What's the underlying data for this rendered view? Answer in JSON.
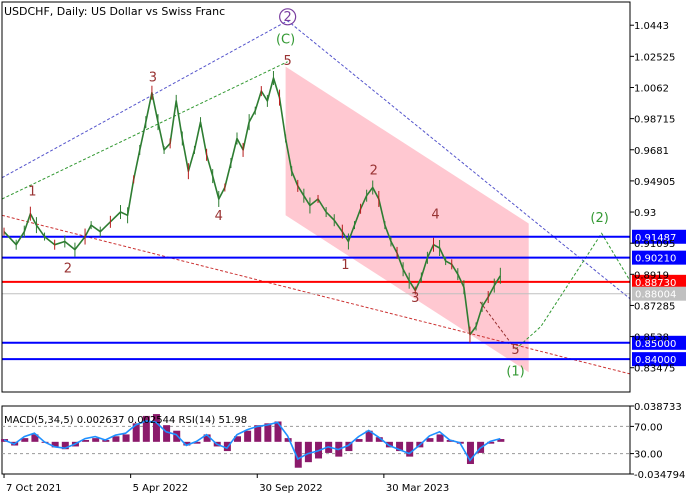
{
  "chart_data": {
    "type": "line",
    "title": "USDCHF, Daily:  US Dollar vs Swiss Franc",
    "price_axis": {
      "range": [
        0.8199,
        1.0585
      ],
      "ticks": [
        1.0443,
        1.02525,
        1.0062,
        0.98715,
        0.9681,
        0.94905,
        0.93,
        0.91095,
        0.8919,
        0.87285,
        0.8538,
        0.83475
      ]
    },
    "time_axis": {
      "labels": [
        {
          "label": "7 Oct 2021",
          "t": 0
        },
        {
          "label": "5 Apr 2022",
          "t": 125
        },
        {
          "label": "30 Sep 2022",
          "t": 250
        },
        {
          "label": "30 Mar 2023",
          "t": 375
        }
      ],
      "range": [
        -2,
        618
      ]
    },
    "price_path": [
      [
        0,
        0.918
      ],
      [
        12,
        0.91
      ],
      [
        20,
        0.918
      ],
      [
        26,
        0.929
      ],
      [
        32,
        0.922
      ],
      [
        40,
        0.915
      ],
      [
        50,
        0.91
      ],
      [
        60,
        0.912
      ],
      [
        70,
        0.907
      ],
      [
        80,
        0.915
      ],
      [
        86,
        0.922
      ],
      [
        95,
        0.918
      ],
      [
        105,
        0.924
      ],
      [
        115,
        0.93
      ],
      [
        122,
        0.928
      ],
      [
        128,
        0.95
      ],
      [
        134,
        0.968
      ],
      [
        140,
        0.985
      ],
      [
        146,
        1.003
      ],
      [
        152,
        0.985
      ],
      [
        158,
        0.968
      ],
      [
        164,
        0.972
      ],
      [
        170,
        0.998
      ],
      [
        176,
        0.975
      ],
      [
        182,
        0.955
      ],
      [
        188,
        0.968
      ],
      [
        194,
        0.985
      ],
      [
        200,
        0.965
      ],
      [
        206,
        0.952
      ],
      [
        212,
        0.938
      ],
      [
        218,
        0.945
      ],
      [
        224,
        0.96
      ],
      [
        230,
        0.975
      ],
      [
        236,
        0.968
      ],
      [
        242,
        0.985
      ],
      [
        248,
        0.992
      ],
      [
        254,
        1.004
      ],
      [
        260,
        0.998
      ],
      [
        266,
        1.012
      ],
      [
        272,
        1.0
      ],
      [
        278,
        0.975
      ],
      [
        284,
        0.955
      ],
      [
        290,
        0.946
      ],
      [
        296,
        0.94
      ],
      [
        302,
        0.934
      ],
      [
        310,
        0.938
      ],
      [
        318,
        0.93
      ],
      [
        326,
        0.925
      ],
      [
        334,
        0.918
      ],
      [
        340,
        0.912
      ],
      [
        346,
        0.922
      ],
      [
        352,
        0.932
      ],
      [
        358,
        0.94
      ],
      [
        364,
        0.945
      ],
      [
        370,
        0.938
      ],
      [
        376,
        0.922
      ],
      [
        382,
        0.912
      ],
      [
        388,
        0.905
      ],
      [
        394,
        0.895
      ],
      [
        400,
        0.888
      ],
      [
        406,
        0.882
      ],
      [
        412,
        0.89
      ],
      [
        418,
        0.902
      ],
      [
        424,
        0.91
      ],
      [
        430,
        0.908
      ],
      [
        436,
        0.9
      ],
      [
        442,
        0.898
      ],
      [
        448,
        0.892
      ],
      [
        454,
        0.884
      ],
      [
        460,
        0.855
      ],
      [
        466,
        0.86
      ],
      [
        472,
        0.872
      ],
      [
        478,
        0.878
      ],
      [
        484,
        0.885
      ],
      [
        490,
        0.891
      ]
    ],
    "horizontal_levels": [
      {
        "value": 0.91487,
        "label": "0.91487",
        "color": "#0000ff"
      },
      {
        "value": 0.9021,
        "label": "0.90210",
        "color": "#0000ff"
      },
      {
        "value": 0.8873,
        "label": "0.88730",
        "color": "#ff0000"
      },
      {
        "value": 0.88004,
        "label": "0.88004",
        "color": "#c0c0c0"
      },
      {
        "value": 0.85,
        "label": "0.85000",
        "color": "#0000ff"
      },
      {
        "value": 0.84,
        "label": "0.84000",
        "color": "#0000ff"
      }
    ],
    "channel": {
      "color": "#ffb6c1",
      "upper": [
        [
          278,
          1.019
        ],
        [
          518,
          0.923
        ]
      ],
      "lower": [
        [
          278,
          0.928
        ],
        [
          518,
          0.832
        ]
      ]
    },
    "trend_lines": [
      {
        "color": "#5555cc",
        "dash": true,
        "points": [
          [
            -2,
            0.951
          ],
          [
            280,
            1.047
          ],
          [
            618,
            0.877
          ]
        ]
      },
      {
        "color": "#cc3333",
        "dash": true,
        "points": [
          [
            -2,
            0.928
          ],
          [
            618,
            0.831
          ]
        ]
      },
      {
        "color": "#339933",
        "dash": true,
        "points": [
          [
            -2,
            0.938
          ],
          [
            280,
            1.022
          ]
        ]
      },
      {
        "color": "#339933",
        "dash": true,
        "points": [
          [
            505,
            0.846
          ],
          [
            530,
            0.86
          ],
          [
            590,
            0.917
          ],
          [
            618,
            0.888
          ]
        ]
      },
      {
        "color": "#993333",
        "dash": true,
        "points": [
          [
            470,
            0.875
          ],
          [
            505,
            0.846
          ]
        ]
      }
    ],
    "wave_labels": [
      {
        "text": "1",
        "t": 28,
        "p": 0.94,
        "color": "#993333"
      },
      {
        "text": "2",
        "t": 63,
        "p": 0.893,
        "color": "#993333"
      },
      {
        "text": "3",
        "t": 147,
        "p": 1.01,
        "color": "#993333"
      },
      {
        "text": "4",
        "t": 212,
        "p": 0.925,
        "color": "#993333"
      },
      {
        "text": "5",
        "t": 280,
        "p": 1.02,
        "color": "#993333"
      },
      {
        "text": "(C)",
        "t": 278,
        "p": 1.033,
        "color": "#339933"
      },
      {
        "text": "2",
        "t": 280,
        "p": 1.047,
        "color": "#7a3fa0",
        "circled": true
      },
      {
        "text": "2",
        "t": 365,
        "p": 0.953,
        "color": "#993333"
      },
      {
        "text": "1",
        "t": 337,
        "p": 0.895,
        "color": "#993333"
      },
      {
        "text": "4",
        "t": 426,
        "p": 0.926,
        "color": "#993333"
      },
      {
        "text": "3",
        "t": 406,
        "p": 0.875,
        "color": "#993333"
      },
      {
        "text": "5",
        "t": 505,
        "p": 0.843,
        "color": "#993333"
      },
      {
        "text": "(1)",
        "t": 505,
        "p": 0.83,
        "color": "#339933"
      },
      {
        "text": "(2)",
        "t": 588,
        "p": 0.924,
        "color": "#339933"
      }
    ],
    "indicator": {
      "label": "MACD(5,34,5) 0.002637 0.002544 RSI(14) 51.98",
      "axis_labels": [
        "0.038733",
        "70.00",
        "30.00",
        "-0.034794"
      ],
      "macd_range": [
        -0.034794,
        0.038733
      ],
      "rsi_levels": [
        70,
        30
      ],
      "macd_hist": [
        [
          0,
          0.003
        ],
        [
          10,
          -0.004
        ],
        [
          20,
          0.004
        ],
        [
          30,
          0.008
        ],
        [
          40,
          0.0
        ],
        [
          50,
          -0.006
        ],
        [
          60,
          -0.008
        ],
        [
          70,
          -0.005
        ],
        [
          80,
          0.002
        ],
        [
          90,
          0.004
        ],
        [
          100,
          0.002
        ],
        [
          110,
          0.006
        ],
        [
          120,
          0.008
        ],
        [
          130,
          0.02
        ],
        [
          140,
          0.028
        ],
        [
          150,
          0.03
        ],
        [
          160,
          0.018
        ],
        [
          170,
          0.012
        ],
        [
          180,
          -0.004
        ],
        [
          190,
          -0.002
        ],
        [
          200,
          0.008
        ],
        [
          210,
          -0.005
        ],
        [
          220,
          -0.01
        ],
        [
          230,
          0.006
        ],
        [
          240,
          0.012
        ],
        [
          250,
          0.018
        ],
        [
          260,
          0.02
        ],
        [
          270,
          0.022
        ],
        [
          280,
          0.004
        ],
        [
          290,
          -0.028
        ],
        [
          300,
          -0.022
        ],
        [
          310,
          -0.018
        ],
        [
          320,
          -0.012
        ],
        [
          330,
          -0.016
        ],
        [
          340,
          -0.01
        ],
        [
          350,
          0.003
        ],
        [
          360,
          0.012
        ],
        [
          370,
          0.005
        ],
        [
          380,
          -0.006
        ],
        [
          390,
          -0.01
        ],
        [
          400,
          -0.016
        ],
        [
          410,
          -0.006
        ],
        [
          420,
          0.004
        ],
        [
          430,
          0.008
        ],
        [
          440,
          0.002
        ],
        [
          450,
          -0.002
        ],
        [
          460,
          -0.024
        ],
        [
          470,
          -0.012
        ],
        [
          480,
          -0.002
        ],
        [
          490,
          0.003
        ]
      ],
      "rsi": [
        [
          0,
          50
        ],
        [
          10,
          44
        ],
        [
          20,
          55
        ],
        [
          30,
          60
        ],
        [
          40,
          47
        ],
        [
          50,
          40
        ],
        [
          60,
          38
        ],
        [
          70,
          44
        ],
        [
          80,
          52
        ],
        [
          90,
          55
        ],
        [
          100,
          50
        ],
        [
          110,
          57
        ],
        [
          120,
          60
        ],
        [
          130,
          72
        ],
        [
          140,
          78
        ],
        [
          150,
          76
        ],
        [
          160,
          62
        ],
        [
          170,
          58
        ],
        [
          180,
          42
        ],
        [
          190,
          48
        ],
        [
          200,
          58
        ],
        [
          210,
          44
        ],
        [
          220,
          38
        ],
        [
          230,
          58
        ],
        [
          240,
          65
        ],
        [
          250,
          70
        ],
        [
          260,
          72
        ],
        [
          270,
          76
        ],
        [
          280,
          56
        ],
        [
          290,
          22
        ],
        [
          300,
          30
        ],
        [
          310,
          34
        ],
        [
          320,
          40
        ],
        [
          330,
          36
        ],
        [
          340,
          42
        ],
        [
          350,
          55
        ],
        [
          360,
          64
        ],
        [
          370,
          54
        ],
        [
          380,
          42
        ],
        [
          390,
          36
        ],
        [
          400,
          30
        ],
        [
          410,
          42
        ],
        [
          420,
          56
        ],
        [
          430,
          62
        ],
        [
          440,
          50
        ],
        [
          450,
          46
        ],
        [
          460,
          20
        ],
        [
          470,
          38
        ],
        [
          480,
          48
        ],
        [
          490,
          52
        ]
      ]
    }
  }
}
